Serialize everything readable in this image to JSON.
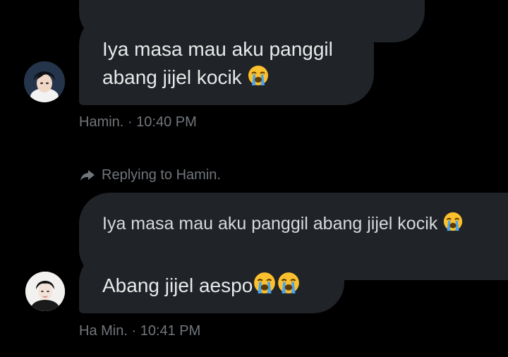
{
  "colors": {
    "background": "#000000",
    "bubble": "#202327",
    "text": "#e7e9ea",
    "meta": "#71767b",
    "emoji_face": "#fbc02d",
    "emoji_tears": "#4aa3ef"
  },
  "messages": [
    {
      "text_line1": "Iya masa mau aku panggil",
      "text_line2": "abang jijel kocik",
      "emoji": "loudly-crying-face",
      "author": "Hamin.",
      "time": "10:40 PM",
      "separator": "·"
    },
    {
      "reply_label": "Replying to Hamin.",
      "quoted_text": "Iya masa mau aku panggil abang jijel kocik",
      "quoted_emoji": "loudly-crying-face",
      "text": "Abang jijel aespo",
      "emoji_count": 2,
      "emoji": "loudly-crying-face",
      "author": "Ha Min.",
      "time": "10:41 PM",
      "separator": "·"
    }
  ],
  "icons": {
    "reply": "reply-arrow-icon",
    "avatar_1": "avatar",
    "avatar_2": "avatar"
  }
}
